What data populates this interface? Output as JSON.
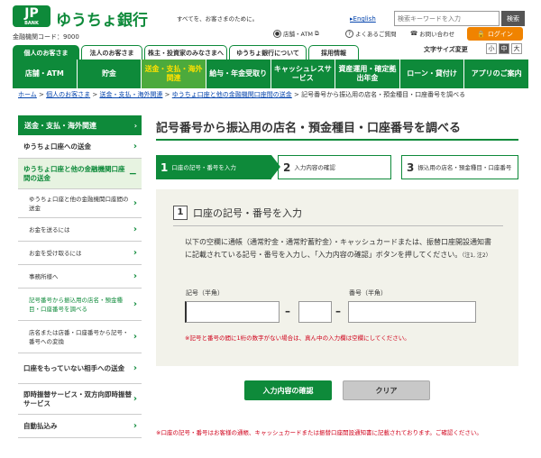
{
  "header": {
    "logo_mark": "JP",
    "logo_sub": "BANK",
    "brand_name": "ゆうちょ銀行",
    "tagline": "すべてを、お客さまのために。",
    "bank_code": "金融機関コード：9000",
    "english_link": "English",
    "search_placeholder": "検索キーワードを入力",
    "search_button": "検索",
    "atm_link": "店舗・ATM",
    "faq_link": "よくあるご質問",
    "contact_link": "お問い合わせ",
    "login_button": "ログイン",
    "font_size_label": "文字サイズ変更",
    "font_sizes": [
      "小",
      "中",
      "大"
    ]
  },
  "audience_tabs": [
    "個人のお客さま",
    "法人のお客さま",
    "株主・投資家のみなさまへ",
    "ゆうちょ銀行について",
    "採用情報"
  ],
  "main_nav": [
    "店舗・ATM",
    "貯金",
    "送金・支払・海外関連",
    "給与・年金受取り",
    "キャッシュレスサービス",
    "資産運用・確定拠出年金",
    "ローン・貸付け",
    "アプリのご案内"
  ],
  "breadcrumb": {
    "links": [
      "ホーム",
      "個人のお客さま",
      "送金・支払・海外関連",
      "ゆうちょ口座と他の金融機関口座間の送金"
    ],
    "current": "記号番号から振込用の店名・預金種目・口座番号を調べる"
  },
  "sidebar": {
    "heading": "送金・支払・海外関連",
    "items": [
      {
        "label": "ゆうちょ口座への送金"
      },
      {
        "label": "ゆうちょ口座と他の金融機関口座間の送金"
      },
      {
        "label": "ゆうちょ口座と他の金融機関口座間の送金"
      },
      {
        "label": "お金を送るには"
      },
      {
        "label": "お金を受け取るには"
      },
      {
        "label": "事務所様へ"
      },
      {
        "label": "記号番号から振込用の店名・預金種目・口座番号を調べる"
      },
      {
        "label": "店名または店番・口座番号から記号・番号への変換"
      },
      {
        "label": "口座をもっていない相手への送金"
      },
      {
        "label": "即時振替サービス・双方向即時振替サービス"
      },
      {
        "label": "自動払込み"
      }
    ]
  },
  "page": {
    "title": "記号番号から振込用の店名・預金種目・口座番号を調べる",
    "steps": [
      {
        "num": "1",
        "label": "口座の記号・番号を入力"
      },
      {
        "num": "2",
        "label": "入力内容の確認"
      },
      {
        "num": "3",
        "label": "振込用の店名・預金種目・口座番号"
      }
    ],
    "section_num": "1",
    "section_title": "口座の記号・番号を入力",
    "instructions": "以下の空欄に通帳（通常貯金・通常貯蓄貯金）・キャッシュカードまたは、振替口座開設通知書に記載されている記号・番号を入力し、「入力内容の確認」ボタンを押してください。",
    "instructions_note": "（注1, 注2）",
    "symbol_label": "記号（半角）",
    "number_label": "番号（半角）",
    "field_note": "※記号と番号の間に1桁の数字がない場合は、真ん中の入力欄は空欄にしてください。",
    "confirm_button": "入力内容の確認",
    "clear_button": "クリア",
    "footer_note": "※口座の記号・番号はお客様の通帳、キャッシュカードまたは振替口座開設通知書に記載されております。ご確認ください。"
  }
}
